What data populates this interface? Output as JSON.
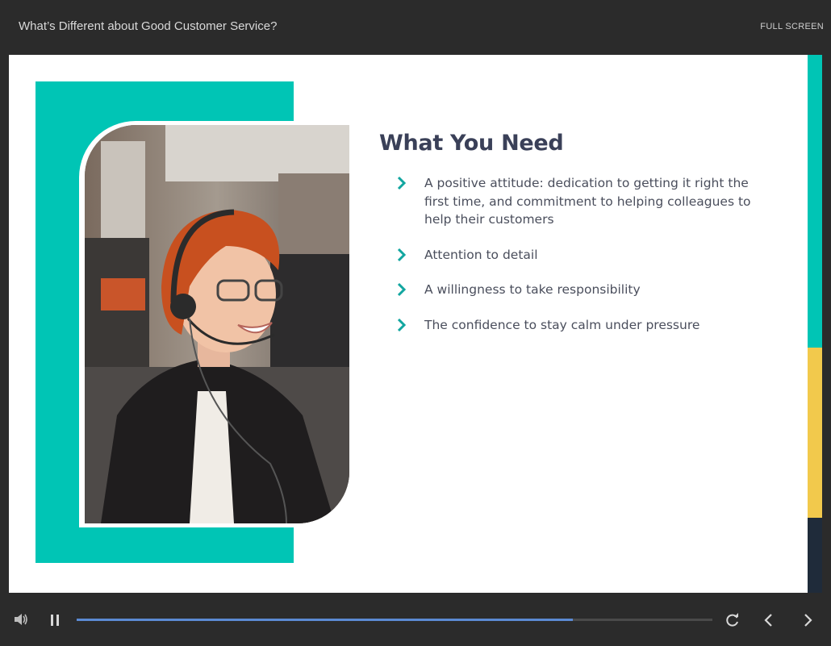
{
  "header": {
    "course_title": "What’s Different about Good Customer Service?",
    "fullscreen_label": "FULL SCREEN"
  },
  "slide": {
    "heading": "What You Need",
    "bullets": [
      "A positive attitude: dedication to getting it right the first time, and commitment to helping colleagues to help their customers",
      "Attention to detail",
      "A willingness to take responsibility",
      "The confidence to stay calm under pressure"
    ],
    "photo_icon": "woman-with-headset-photo"
  },
  "colors": {
    "accent_teal": "#00c5b5",
    "accent_yellow": "#f2c94c",
    "heading": "#3a4058",
    "progress_fill": "#5b8ad3"
  },
  "controls": {
    "volume_icon": "volume-icon",
    "pause_icon": "pause-icon",
    "progress_fraction": 0.78,
    "replay_icon": "replay-icon",
    "prev_icon": "chevron-left-icon",
    "next_icon": "chevron-right-icon"
  }
}
